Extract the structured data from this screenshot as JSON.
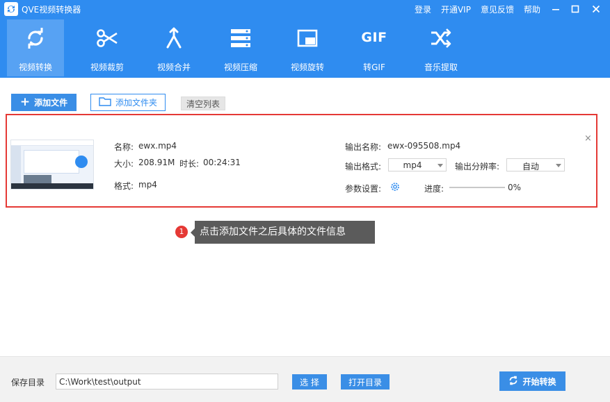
{
  "window": {
    "title": "QVE视频转换器",
    "links": [
      "登录",
      "开通VIP",
      "意见反馈",
      "帮助"
    ]
  },
  "nav": [
    {
      "label": "视频转换",
      "icon": "refresh-icon",
      "active": true
    },
    {
      "label": "视频裁剪",
      "icon": "scissors-icon"
    },
    {
      "label": "视频合并",
      "icon": "merge-icon"
    },
    {
      "label": "视频压缩",
      "icon": "compress-icon"
    },
    {
      "label": "视频旋转",
      "icon": "rotate-icon"
    },
    {
      "label": "转GIF",
      "icon": "gif-icon",
      "icon_text": "GIF"
    },
    {
      "label": "音乐提取",
      "icon": "shuffle-icon"
    }
  ],
  "toolbar": {
    "add_file": "添加文件",
    "add_folder": "添加文件夹",
    "clear_list": "清空列表"
  },
  "file": {
    "name_label": "名称:",
    "name": "ewx.mp4",
    "size_label": "大小:",
    "size": "208.91M",
    "duration_label": "时长:",
    "duration": "00:24:31",
    "format_label": "格式:",
    "format": "mp4",
    "output_name_label": "输出名称:",
    "output_name": "ewx-095508.mp4",
    "output_format_label": "输出格式:",
    "output_format": "mp4",
    "output_resolution_label": "输出分辨率:",
    "output_resolution": "自动",
    "params_label": "参数设置:",
    "progress_label": "进度:",
    "progress": "0%",
    "progress_value": 0
  },
  "tooltip": {
    "number": "1",
    "text": "点击添加文件之后具体的文件信息"
  },
  "footer": {
    "save_label": "保存目录",
    "save_path": "C:\\Work\\test\\output",
    "choose": "选 择",
    "open_dir": "打开目录",
    "start": "开始转换"
  },
  "colors": {
    "primary": "#2f8cf0",
    "highlight_border": "#e53935",
    "tooltip_bg": "#5b5b5b"
  }
}
